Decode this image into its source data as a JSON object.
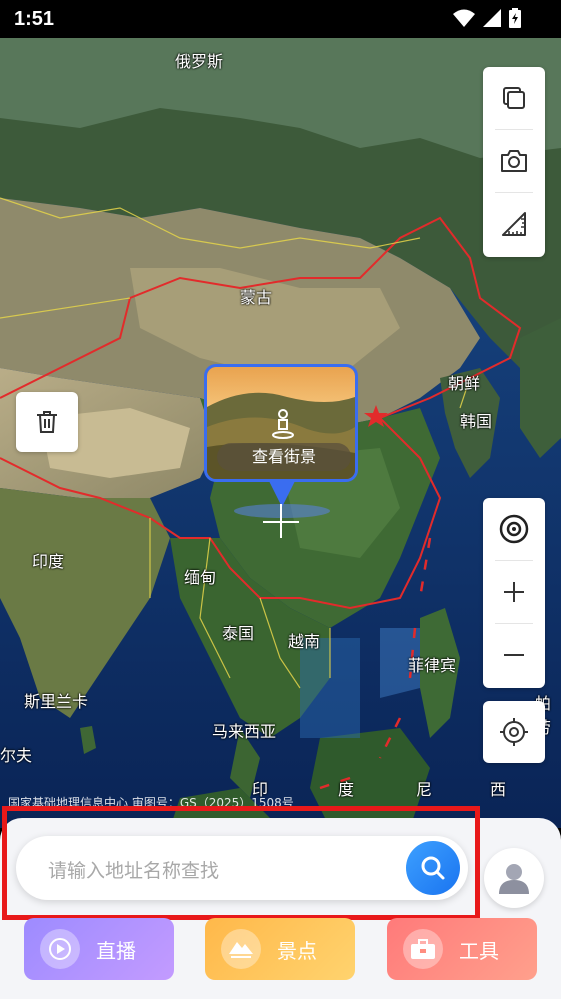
{
  "status_bar": {
    "time": "1:51"
  },
  "map": {
    "labels": {
      "russia": "俄罗斯",
      "mongolia": "蒙古",
      "north_korea": "朝鲜",
      "south_korea": "韩国",
      "india": "印度",
      "myanmar": "缅甸",
      "thailand": "泰国",
      "vietnam": "越南",
      "philippines": "菲律宾",
      "sri_lanka": "斯里兰卡",
      "malaysia": "马来西亚",
      "maldives": "尔夫",
      "indonesia_1": "印",
      "indonesia_2": "度",
      "indonesia_3": "尼",
      "indonesia_4": "西",
      "palau": "帕劳"
    },
    "copyright": "国家基础地理信息中心  审图号：GS（2025）1508号"
  },
  "street_view": {
    "label": "查看街景"
  },
  "search": {
    "placeholder": "请输入地址名称查找"
  },
  "actions": {
    "live": "直播",
    "scenic": "景点",
    "tools": "工具"
  },
  "colors": {
    "accent": "#3a6df0",
    "highlight": "#e8191a",
    "search_button": "#1a74f0"
  }
}
